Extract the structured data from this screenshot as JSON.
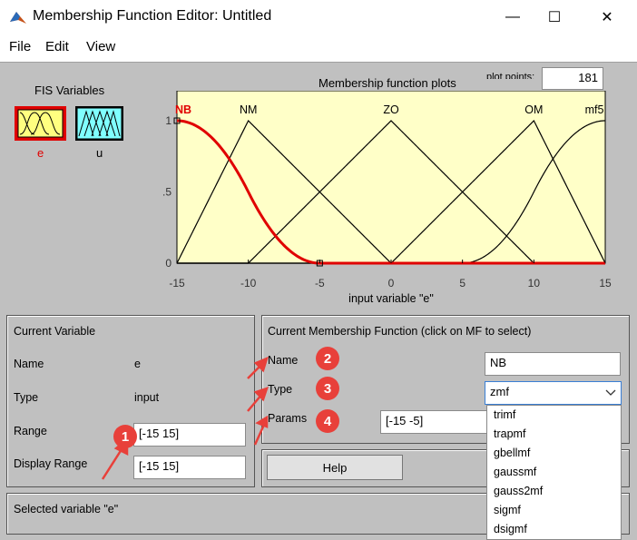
{
  "window": {
    "title": "Membership Function Editor: Untitled",
    "min": "—",
    "max": "☐",
    "close": "✕"
  },
  "menu": [
    "File",
    "Edit",
    "View"
  ],
  "fis": {
    "label": "FIS Variables",
    "input_name": "e",
    "output_name": "u"
  },
  "plot": {
    "title": "Membership function plots",
    "plot_points_label": "plot points:",
    "plot_points": "181",
    "xlabel": "input variable \"e\"",
    "xticks": [
      "-15",
      "-10",
      "-5",
      "0",
      "5",
      "10",
      "15"
    ],
    "yticks": [
      "0",
      "0.5",
      "1"
    ],
    "mf_labels": [
      "NB",
      "NM",
      "ZO",
      "OM",
      "mf5"
    ]
  },
  "chart_data": {
    "type": "line",
    "title": "Membership function plots",
    "xlabel": "input variable \"e\"",
    "ylabel": "",
    "xlim": [
      -15,
      15
    ],
    "ylim": [
      0,
      1
    ],
    "series": [
      {
        "name": "NB",
        "kind": "zmf",
        "params": [
          -15,
          -5
        ],
        "color": "#e00000"
      },
      {
        "name": "NM",
        "kind": "trimf",
        "params": [
          -15,
          -10,
          0
        ],
        "color": "#000000"
      },
      {
        "name": "ZO",
        "kind": "trimf",
        "params": [
          -10,
          0,
          10
        ],
        "color": "#000000"
      },
      {
        "name": "OM",
        "kind": "trimf",
        "params": [
          0,
          10,
          15
        ],
        "color": "#000000"
      },
      {
        "name": "mf5",
        "kind": "smf",
        "params": [
          5,
          15
        ],
        "color": "#000000"
      }
    ]
  },
  "current_variable": {
    "heading": "Current Variable",
    "name_label": "Name",
    "name_value": "e",
    "type_label": "Type",
    "type_value": "input",
    "range_label": "Range",
    "range_value": "[-15 15]",
    "display_range_label": "Display Range",
    "display_range_value": "[-15 15]"
  },
  "current_mf": {
    "heading": "Current Membership Function (click on MF to select)",
    "name_label": "Name",
    "name_value": "NB",
    "type_label": "Type",
    "type_value": "zmf",
    "params_label": "Params",
    "params_value": "[-15 -5]",
    "type_options": [
      "trimf",
      "trapmf",
      "gbellmf",
      "gaussmf",
      "gauss2mf",
      "sigmf",
      "dsigmf"
    ]
  },
  "help_label": "Help",
  "status": "Selected variable \"e\"",
  "badges": [
    "1",
    "2",
    "3",
    "4"
  ],
  "colors": {
    "selected_mf": "#e00000",
    "plot_bg": "#ffffc8",
    "input_icon": "#ffff80",
    "output_icon": "#80ffff",
    "badge": "#e8403a"
  }
}
